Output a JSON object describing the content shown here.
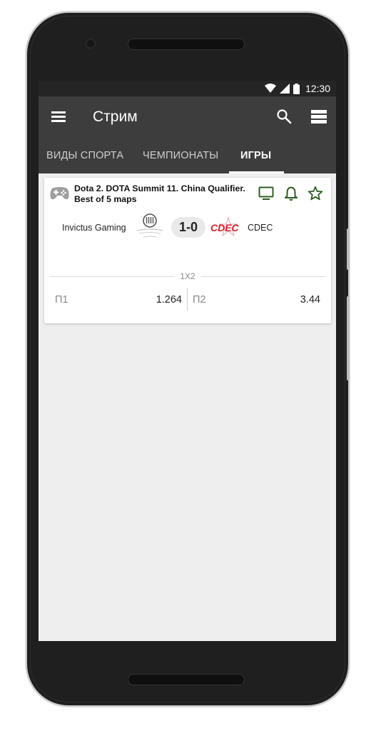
{
  "status_bar": {
    "time": "12:30"
  },
  "app_bar": {
    "title": "Стрим"
  },
  "tabs": [
    {
      "label": "ВИДЫ СПОРТА"
    },
    {
      "label": "ЧЕМПИОНАТЫ"
    },
    {
      "label": "ИГРЫ",
      "active": true
    }
  ],
  "match": {
    "event_title": "Dota 2. DOTA Summit 11. China Qualifier. Best of 5 maps",
    "team1": "Invictus Gaming",
    "team2": "CDEC",
    "team2_logo_text": "CDEC",
    "score": "1-0",
    "market": "1X2",
    "odds": [
      {
        "label": "П1",
        "value": "1.264"
      },
      {
        "label": "П2",
        "value": "3.44"
      }
    ]
  },
  "icons": {
    "menu": "hamburger-menu-icon",
    "search": "search-icon",
    "view": "list-view-icon",
    "game": "gamepad-icon",
    "tv": "tv-icon",
    "bell": "bell-icon",
    "star": "star-icon"
  },
  "colors": {
    "app_bar": "#3d3d3d",
    "status_bar": "#252525",
    "accent_green": "#2e5e22",
    "cdec_red": "#d0232b",
    "screen_bg": "#eeeeee"
  }
}
